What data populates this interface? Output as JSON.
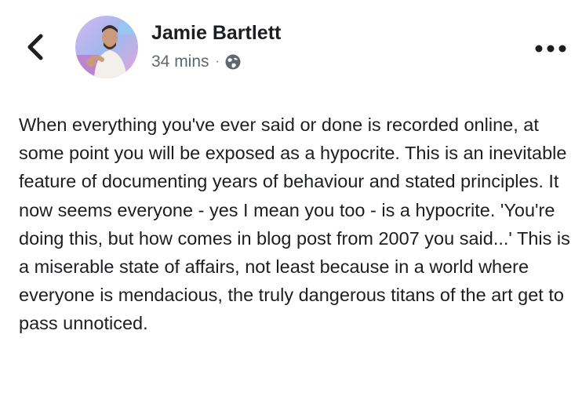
{
  "post": {
    "author": "Jamie Bartlett",
    "time": "34 mins",
    "separator": "·",
    "privacy_icon": "globe-icon",
    "body": "When everything you've ever said or done is recorded online, at some point you will be exposed as a hypocrite. This is an inevitable feature of documenting years of behaviour and stated principles. It now seems everyone - yes I mean you too - is a hypocrite. 'You're doing this, but how comes in blog post from 2007 you said...' This is a miserable state of affairs, not least because in a world where everyone is mendacious, the truly dangerous titans of the art get to pass unnoticed."
  },
  "icons": {
    "back": "chevron-left-icon",
    "more": "more-options-icon",
    "avatar": "avatar"
  },
  "colors": {
    "text": "#1c1e21",
    "secondary": "#606770",
    "background": "#ffffff"
  }
}
